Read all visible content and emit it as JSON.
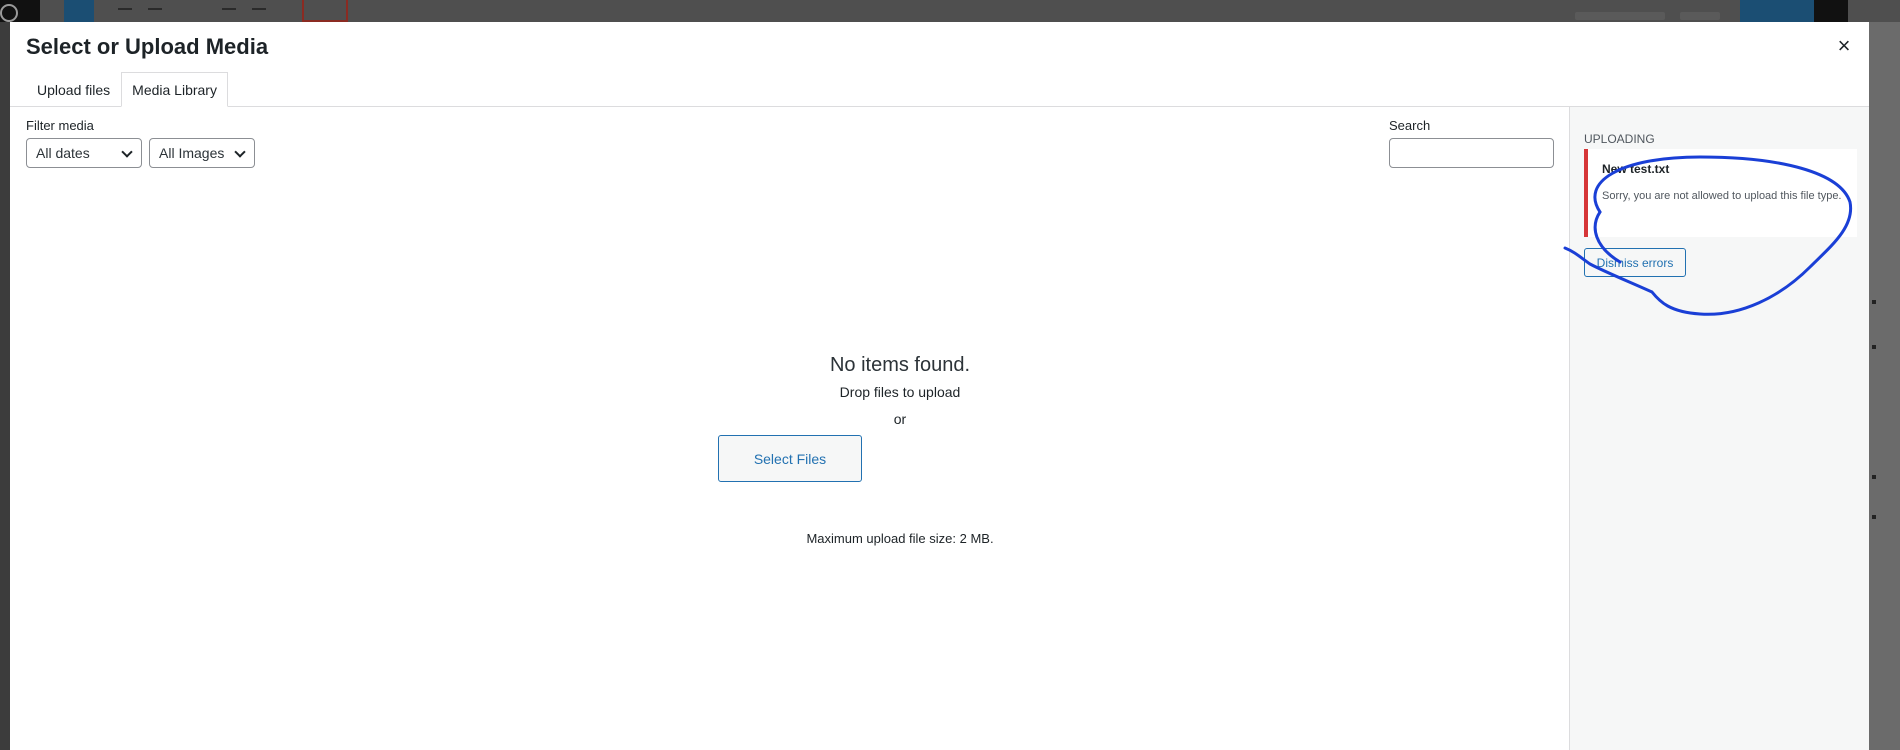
{
  "modal": {
    "title": "Select or Upload Media",
    "close_label": "×"
  },
  "tabs": [
    {
      "label": "Upload files",
      "active": false
    },
    {
      "label": "Media Library",
      "active": true
    }
  ],
  "filters": {
    "label": "Filter media",
    "dates_value": "All dates",
    "types_value": "All Images"
  },
  "search": {
    "label": "Search",
    "value": ""
  },
  "empty_state": {
    "title": "No items found.",
    "drop_text": "Drop files to upload",
    "or_text": "or",
    "select_files_label": "Select Files",
    "max_size_text": "Maximum upload file size: 2 MB."
  },
  "sidebar": {
    "uploading_label": "Uploading",
    "error": {
      "filename": "New test.txt",
      "message": "Sorry, you are not allowed to upload this file type."
    },
    "dismiss_label": "Dismiss errors"
  },
  "colors": {
    "accent": "#2271b1",
    "error": "#d63638",
    "annotation": "#1a3fd6"
  }
}
